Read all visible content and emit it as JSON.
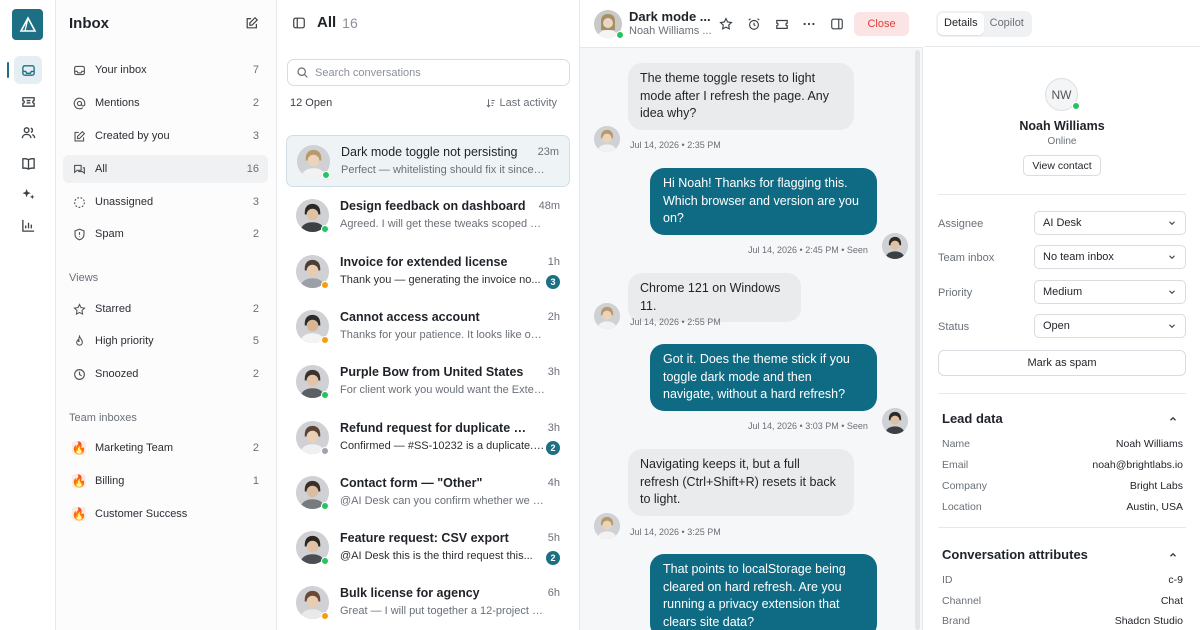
{
  "nav": {
    "title": "Inbox",
    "items": [
      {
        "label": "Your inbox",
        "count": "7"
      },
      {
        "label": "Mentions",
        "count": "2"
      },
      {
        "label": "Created by you",
        "count": "3"
      },
      {
        "label": "All",
        "count": "16"
      },
      {
        "label": "Unassigned",
        "count": "3"
      },
      {
        "label": "Spam",
        "count": "2"
      }
    ],
    "views_title": "Views",
    "views": [
      {
        "label": "Starred",
        "count": "2"
      },
      {
        "label": "High priority",
        "count": "5"
      },
      {
        "label": "Snoozed",
        "count": "2"
      }
    ],
    "team_title": "Team inboxes",
    "teams": [
      {
        "label": "Marketing Team",
        "count": "2"
      },
      {
        "label": "Billing",
        "count": "1"
      },
      {
        "label": "Customer Success",
        "count": ""
      }
    ]
  },
  "list": {
    "title": "All",
    "count": "16",
    "search_placeholder": "Search conversations",
    "open_count": "12 Open",
    "sort_label": "Last activity",
    "items": [
      {
        "title": "Dark mode toggle not persisting",
        "time": "23m",
        "preview": "Perfect — whitelisting should fix it since we...",
        "badge": "",
        "status": "online"
      },
      {
        "title": "Design feedback on dashboard",
        "time": "48m",
        "preview": "Agreed. I will get these tweaks scoped and...",
        "badge": "",
        "status": "online"
      },
      {
        "title": "Invoice for extended license",
        "time": "1h",
        "preview": "Thank you — generating the invoice no...",
        "badge": "3",
        "status": "away"
      },
      {
        "title": "Cannot access account",
        "time": "2h",
        "preview": "Thanks for your patience. It looks like our...",
        "badge": "",
        "status": "away"
      },
      {
        "title": "Purple Bow from United States",
        "time": "3h",
        "preview": "For client work you would want the Extende...",
        "badge": "",
        "status": "online"
      },
      {
        "title": "Refund request for duplicate pur...",
        "time": "3h",
        "preview": "Confirmed — #SS-10232 is a duplicate. I...",
        "badge": "2",
        "status": "offline"
      },
      {
        "title": "Contact form — \"Other\"",
        "time": "4h",
        "preview": "@AI Desk can you confirm whether we ship ...",
        "badge": "",
        "status": "online"
      },
      {
        "title": "Feature request: CSV export",
        "time": "5h",
        "preview": "@AI Desk this is the third request this...",
        "badge": "2",
        "status": "online"
      },
      {
        "title": "Bulk license for agency",
        "time": "6h",
        "preview": "Great — I will put together a 12-project bulk...",
        "badge": "",
        "status": "away"
      }
    ]
  },
  "chat": {
    "contact_name": "Dark mode ...",
    "contact_sub": "Noah Williams ...",
    "close_label": "Close",
    "messages": [
      {
        "dir": "in",
        "text": "The theme toggle resets to light mode after I refresh the page. Any idea why?",
        "meta": "Jul 14, 2026 • 2:35 PM"
      },
      {
        "dir": "out",
        "text": "Hi Noah! Thanks for flagging this. Which browser and version are you on?",
        "meta": "Jul 14, 2026 • 2:45 PM • Seen"
      },
      {
        "dir": "in",
        "text": "Chrome 121 on Windows 11.",
        "meta": "Jul 14, 2026 • 2:55 PM"
      },
      {
        "dir": "out",
        "text": "Got it. Does the theme stick if you toggle dark mode and then navigate, without a hard refresh?",
        "meta": "Jul 14, 2026 • 3:03 PM • Seen"
      },
      {
        "dir": "in",
        "text": "Navigating keeps it, but a full refresh (Ctrl+Shift+R) resets it back to light.",
        "meta": "Jul 14, 2026 • 3:25 PM"
      },
      {
        "dir": "out",
        "text": "That points to localStorage being cleared on hard refresh. Are you running a privacy extension that clears site data?",
        "meta": ""
      }
    ]
  },
  "details": {
    "tabs": [
      "Details",
      "Copilot"
    ],
    "initials": "NW",
    "name": "Noah Williams",
    "status": "Online",
    "view_contact": "View contact",
    "fields": [
      {
        "label": "Assignee",
        "value": "AI Desk"
      },
      {
        "label": "Team inbox",
        "value": "No team inbox"
      },
      {
        "label": "Priority",
        "value": "Medium"
      },
      {
        "label": "Status",
        "value": "Open"
      }
    ],
    "spam_label": "Mark as spam",
    "lead_title": "Lead data",
    "lead": [
      {
        "k": "Name",
        "v": "Noah Williams"
      },
      {
        "k": "Email",
        "v": "noah@brightlabs.io"
      },
      {
        "k": "Company",
        "v": "Bright Labs"
      },
      {
        "k": "Location",
        "v": "Austin, USA"
      }
    ],
    "attr_title": "Conversation attributes",
    "attrs": [
      {
        "k": "ID",
        "v": "c-9"
      },
      {
        "k": "Channel",
        "v": "Chat"
      },
      {
        "k": "Brand",
        "v": "Shadcn Studio"
      }
    ]
  },
  "colors": {
    "accent": "#0f6b84",
    "online": "#22c55e",
    "away": "#f59e0b",
    "offline": "#9ca3af",
    "close_bg": "#fde4e4",
    "close_fg": "#dc3c3c"
  }
}
